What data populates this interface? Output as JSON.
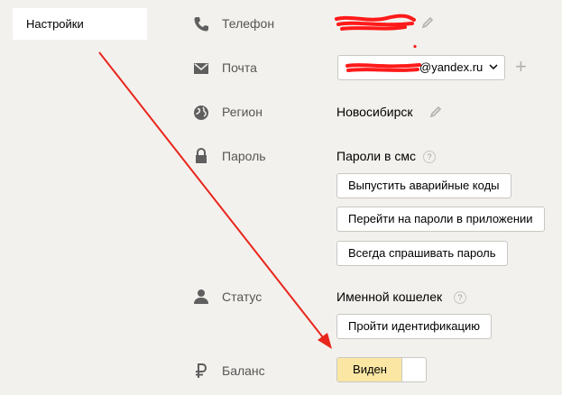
{
  "sidebar": {
    "items": [
      {
        "label": "Настройки"
      }
    ]
  },
  "rows": {
    "phone": {
      "label": "Телефон",
      "icon": "phone-icon"
    },
    "mail": {
      "label": "Почта",
      "icon": "mail-icon",
      "email_suffix": "@yandex.ru"
    },
    "region": {
      "label": "Регион",
      "icon": "globe-icon",
      "value": "Новосибирск"
    },
    "password": {
      "label": "Пароль",
      "icon": "lock-icon",
      "value": "Пароли в смс",
      "buttons": [
        "Выпустить аварийные коды",
        "Перейти на пароли в приложении",
        "Всегда спрашивать пароль"
      ]
    },
    "status": {
      "label": "Статус",
      "icon": "person-icon",
      "value": "Именной кошелек",
      "button": "Пройти идентификацию"
    },
    "balance": {
      "label": "Баланс",
      "icon": "ruble-icon",
      "toggle_label": "Виден"
    }
  },
  "help_glyph": "?",
  "plus_glyph": "+",
  "annotation": {
    "arrow_color": "#e8261c",
    "redaction_color": "#ff1a1a"
  }
}
